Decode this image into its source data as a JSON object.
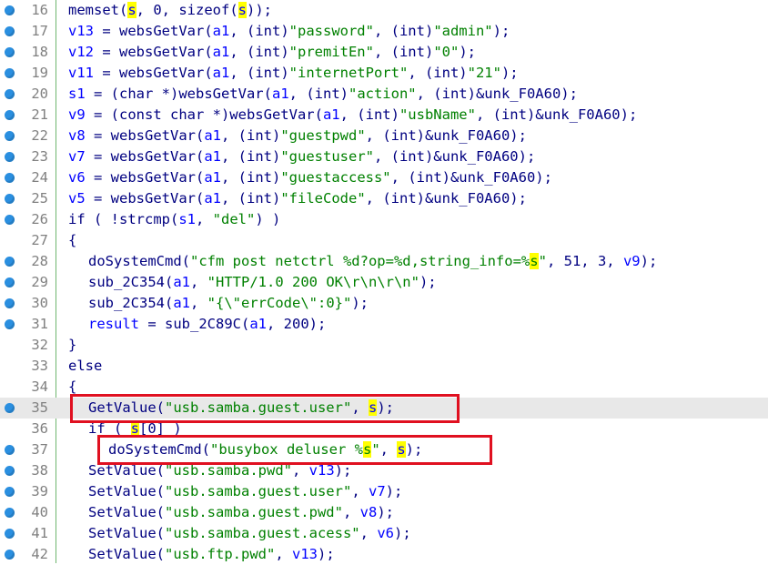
{
  "editor": {
    "lines": [
      {
        "num": "16",
        "dot": true,
        "highlighted": false,
        "indent": 0,
        "tokens": [
          {
            "t": "p",
            "v": "memset("
          },
          {
            "t": "vh",
            "v": "s"
          },
          {
            "t": "p",
            "v": ", 0, sizeof("
          },
          {
            "t": "vh",
            "v": "s"
          },
          {
            "t": "p",
            "v": "));"
          }
        ]
      },
      {
        "num": "17",
        "dot": true,
        "highlighted": false,
        "indent": 0,
        "tokens": [
          {
            "t": "v",
            "v": "v13"
          },
          {
            "t": "p",
            "v": " = websGetVar("
          },
          {
            "t": "v",
            "v": "a1"
          },
          {
            "t": "p",
            "v": ", (int)"
          },
          {
            "t": "s",
            "v": "\"password\""
          },
          {
            "t": "p",
            "v": ", (int)"
          },
          {
            "t": "s",
            "v": "\"admin\""
          },
          {
            "t": "p",
            "v": ");"
          }
        ]
      },
      {
        "num": "18",
        "dot": true,
        "highlighted": false,
        "indent": 0,
        "tokens": [
          {
            "t": "v",
            "v": "v12"
          },
          {
            "t": "p",
            "v": " = websGetVar("
          },
          {
            "t": "v",
            "v": "a1"
          },
          {
            "t": "p",
            "v": ", (int)"
          },
          {
            "t": "s",
            "v": "\"premitEn\""
          },
          {
            "t": "p",
            "v": ", (int)"
          },
          {
            "t": "s",
            "v": "\"0\""
          },
          {
            "t": "p",
            "v": ");"
          }
        ]
      },
      {
        "num": "19",
        "dot": true,
        "highlighted": false,
        "indent": 0,
        "tokens": [
          {
            "t": "v",
            "v": "v11"
          },
          {
            "t": "p",
            "v": " = websGetVar("
          },
          {
            "t": "v",
            "v": "a1"
          },
          {
            "t": "p",
            "v": ", (int)"
          },
          {
            "t": "s",
            "v": "\"internetPort\""
          },
          {
            "t": "p",
            "v": ", (int)"
          },
          {
            "t": "s",
            "v": "\"21\""
          },
          {
            "t": "p",
            "v": ");"
          }
        ]
      },
      {
        "num": "20",
        "dot": true,
        "highlighted": false,
        "indent": 0,
        "tokens": [
          {
            "t": "v",
            "v": "s1"
          },
          {
            "t": "p",
            "v": " = (char *)websGetVar("
          },
          {
            "t": "v",
            "v": "a1"
          },
          {
            "t": "p",
            "v": ", (int)"
          },
          {
            "t": "s",
            "v": "\"action\""
          },
          {
            "t": "p",
            "v": ", (int)&unk_F0A60);"
          }
        ]
      },
      {
        "num": "21",
        "dot": true,
        "highlighted": false,
        "indent": 0,
        "tokens": [
          {
            "t": "v",
            "v": "v9"
          },
          {
            "t": "p",
            "v": " = (const char *)websGetVar("
          },
          {
            "t": "v",
            "v": "a1"
          },
          {
            "t": "p",
            "v": ", (int)"
          },
          {
            "t": "s",
            "v": "\"usbName\""
          },
          {
            "t": "p",
            "v": ", (int)&unk_F0A60);"
          }
        ]
      },
      {
        "num": "22",
        "dot": true,
        "highlighted": false,
        "indent": 0,
        "tokens": [
          {
            "t": "v",
            "v": "v8"
          },
          {
            "t": "p",
            "v": " = websGetVar("
          },
          {
            "t": "v",
            "v": "a1"
          },
          {
            "t": "p",
            "v": ", (int)"
          },
          {
            "t": "s",
            "v": "\"guestpwd\""
          },
          {
            "t": "p",
            "v": ", (int)&unk_F0A60);"
          }
        ]
      },
      {
        "num": "23",
        "dot": true,
        "highlighted": false,
        "indent": 0,
        "tokens": [
          {
            "t": "v",
            "v": "v7"
          },
          {
            "t": "p",
            "v": " = websGetVar("
          },
          {
            "t": "v",
            "v": "a1"
          },
          {
            "t": "p",
            "v": ", (int)"
          },
          {
            "t": "s",
            "v": "\"guestuser\""
          },
          {
            "t": "p",
            "v": ", (int)&unk_F0A60);"
          }
        ]
      },
      {
        "num": "24",
        "dot": true,
        "highlighted": false,
        "indent": 0,
        "tokens": [
          {
            "t": "v",
            "v": "v6"
          },
          {
            "t": "p",
            "v": " = websGetVar("
          },
          {
            "t": "v",
            "v": "a1"
          },
          {
            "t": "p",
            "v": ", (int)"
          },
          {
            "t": "s",
            "v": "\"guestaccess\""
          },
          {
            "t": "p",
            "v": ", (int)&unk_F0A60);"
          }
        ]
      },
      {
        "num": "25",
        "dot": true,
        "highlighted": false,
        "indent": 0,
        "tokens": [
          {
            "t": "v",
            "v": "v5"
          },
          {
            "t": "p",
            "v": " = websGetVar("
          },
          {
            "t": "v",
            "v": "a1"
          },
          {
            "t": "p",
            "v": ", (int)"
          },
          {
            "t": "s",
            "v": "\"fileCode\""
          },
          {
            "t": "p",
            "v": ", (int)&unk_F0A60);"
          }
        ]
      },
      {
        "num": "26",
        "dot": true,
        "highlighted": false,
        "indent": 0,
        "tokens": [
          {
            "t": "p",
            "v": "if ( !strcmp("
          },
          {
            "t": "v",
            "v": "s1"
          },
          {
            "t": "p",
            "v": ", "
          },
          {
            "t": "s",
            "v": "\"del\""
          },
          {
            "t": "p",
            "v": ") )"
          }
        ]
      },
      {
        "num": "27",
        "dot": false,
        "highlighted": false,
        "indent": 0,
        "tokens": [
          {
            "t": "p",
            "v": "{"
          }
        ]
      },
      {
        "num": "28",
        "dot": true,
        "highlighted": false,
        "indent": 1,
        "tokens": [
          {
            "t": "p",
            "v": "doSystemCmd("
          },
          {
            "t": "s",
            "v": "\"cfm post netctrl %d?op=%d,string_info=%"
          },
          {
            "t": "sh",
            "v": "s"
          },
          {
            "t": "s",
            "v": "\""
          },
          {
            "t": "p",
            "v": ", 51, 3, "
          },
          {
            "t": "v",
            "v": "v9"
          },
          {
            "t": "p",
            "v": ");"
          }
        ]
      },
      {
        "num": "29",
        "dot": true,
        "highlighted": false,
        "indent": 1,
        "tokens": [
          {
            "t": "p",
            "v": "sub_2C354("
          },
          {
            "t": "v",
            "v": "a1"
          },
          {
            "t": "p",
            "v": ", "
          },
          {
            "t": "s",
            "v": "\"HTTP/1.0 200 OK\\r\\n\\r\\n\""
          },
          {
            "t": "p",
            "v": ");"
          }
        ]
      },
      {
        "num": "30",
        "dot": true,
        "highlighted": false,
        "indent": 1,
        "tokens": [
          {
            "t": "p",
            "v": "sub_2C354("
          },
          {
            "t": "v",
            "v": "a1"
          },
          {
            "t": "p",
            "v": ", "
          },
          {
            "t": "s",
            "v": "\"{\\\"errCode\\\":0}\""
          },
          {
            "t": "p",
            "v": ");"
          }
        ]
      },
      {
        "num": "31",
        "dot": true,
        "highlighted": false,
        "indent": 1,
        "tokens": [
          {
            "t": "v",
            "v": "result"
          },
          {
            "t": "p",
            "v": " = sub_2C89C("
          },
          {
            "t": "v",
            "v": "a1"
          },
          {
            "t": "p",
            "v": ", 200);"
          }
        ]
      },
      {
        "num": "32",
        "dot": false,
        "highlighted": false,
        "indent": 0,
        "tokens": [
          {
            "t": "p",
            "v": "}"
          }
        ]
      },
      {
        "num": "33",
        "dot": false,
        "highlighted": false,
        "indent": 0,
        "tokens": [
          {
            "t": "p",
            "v": "else"
          }
        ]
      },
      {
        "num": "34",
        "dot": false,
        "highlighted": false,
        "indent": 0,
        "tokens": [
          {
            "t": "p",
            "v": "{"
          }
        ]
      },
      {
        "num": "35",
        "dot": true,
        "highlighted": true,
        "indent": 1,
        "tokens": [
          {
            "t": "p",
            "v": "GetValue("
          },
          {
            "t": "s",
            "v": "\"usb.samba.guest.user\""
          },
          {
            "t": "p",
            "v": ", "
          },
          {
            "t": "vh",
            "v": "s"
          },
          {
            "t": "p",
            "v": ");"
          }
        ]
      },
      {
        "num": "36",
        "dot": false,
        "highlighted": false,
        "indent": 1,
        "tokens": [
          {
            "t": "p",
            "v": "if ( "
          },
          {
            "t": "vh",
            "v": "s"
          },
          {
            "t": "p",
            "v": "[0] )"
          }
        ]
      },
      {
        "num": "37",
        "dot": true,
        "highlighted": false,
        "indent": 2,
        "tokens": [
          {
            "t": "p",
            "v": "doSystemCmd("
          },
          {
            "t": "s",
            "v": "\"busybox deluser %"
          },
          {
            "t": "sh",
            "v": "s"
          },
          {
            "t": "s",
            "v": "\""
          },
          {
            "t": "p",
            "v": ", "
          },
          {
            "t": "vh",
            "v": "s"
          },
          {
            "t": "p",
            "v": ");"
          }
        ]
      },
      {
        "num": "38",
        "dot": true,
        "highlighted": false,
        "indent": 1,
        "tokens": [
          {
            "t": "p",
            "v": "SetValue("
          },
          {
            "t": "s",
            "v": "\"usb.samba.pwd\""
          },
          {
            "t": "p",
            "v": ", "
          },
          {
            "t": "v",
            "v": "v13"
          },
          {
            "t": "p",
            "v": ");"
          }
        ]
      },
      {
        "num": "39",
        "dot": true,
        "highlighted": false,
        "indent": 1,
        "tokens": [
          {
            "t": "p",
            "v": "SetValue("
          },
          {
            "t": "s",
            "v": "\"usb.samba.guest.user\""
          },
          {
            "t": "p",
            "v": ", "
          },
          {
            "t": "v",
            "v": "v7"
          },
          {
            "t": "p",
            "v": ");"
          }
        ]
      },
      {
        "num": "40",
        "dot": true,
        "highlighted": false,
        "indent": 1,
        "tokens": [
          {
            "t": "p",
            "v": "SetValue("
          },
          {
            "t": "s",
            "v": "\"usb.samba.guest.pwd\""
          },
          {
            "t": "p",
            "v": ", "
          },
          {
            "t": "v",
            "v": "v8"
          },
          {
            "t": "p",
            "v": ");"
          }
        ]
      },
      {
        "num": "41",
        "dot": true,
        "highlighted": false,
        "indent": 1,
        "tokens": [
          {
            "t": "p",
            "v": "SetValue("
          },
          {
            "t": "s",
            "v": "\"usb.samba.guest.acess\""
          },
          {
            "t": "p",
            "v": ", "
          },
          {
            "t": "v",
            "v": "v6"
          },
          {
            "t": "p",
            "v": ");"
          }
        ]
      },
      {
        "num": "42",
        "dot": true,
        "highlighted": false,
        "indent": 1,
        "tokens": [
          {
            "t": "p",
            "v": "SetValue("
          },
          {
            "t": "s",
            "v": "\"usb.ftp.pwd\""
          },
          {
            "t": "p",
            "v": ", "
          },
          {
            "t": "v",
            "v": "v13"
          },
          {
            "t": "p",
            "v": ");"
          }
        ]
      }
    ]
  },
  "colors": {
    "plain": "#000080",
    "variable": "#0000ff",
    "string": "#008000",
    "highlight": "#ffff00",
    "breakpoint_dot": "#2a8fe0",
    "annotation_box": "#e01020"
  },
  "annotations": [
    {
      "label": "red-box-line-35"
    },
    {
      "label": "red-box-line-37"
    }
  ]
}
